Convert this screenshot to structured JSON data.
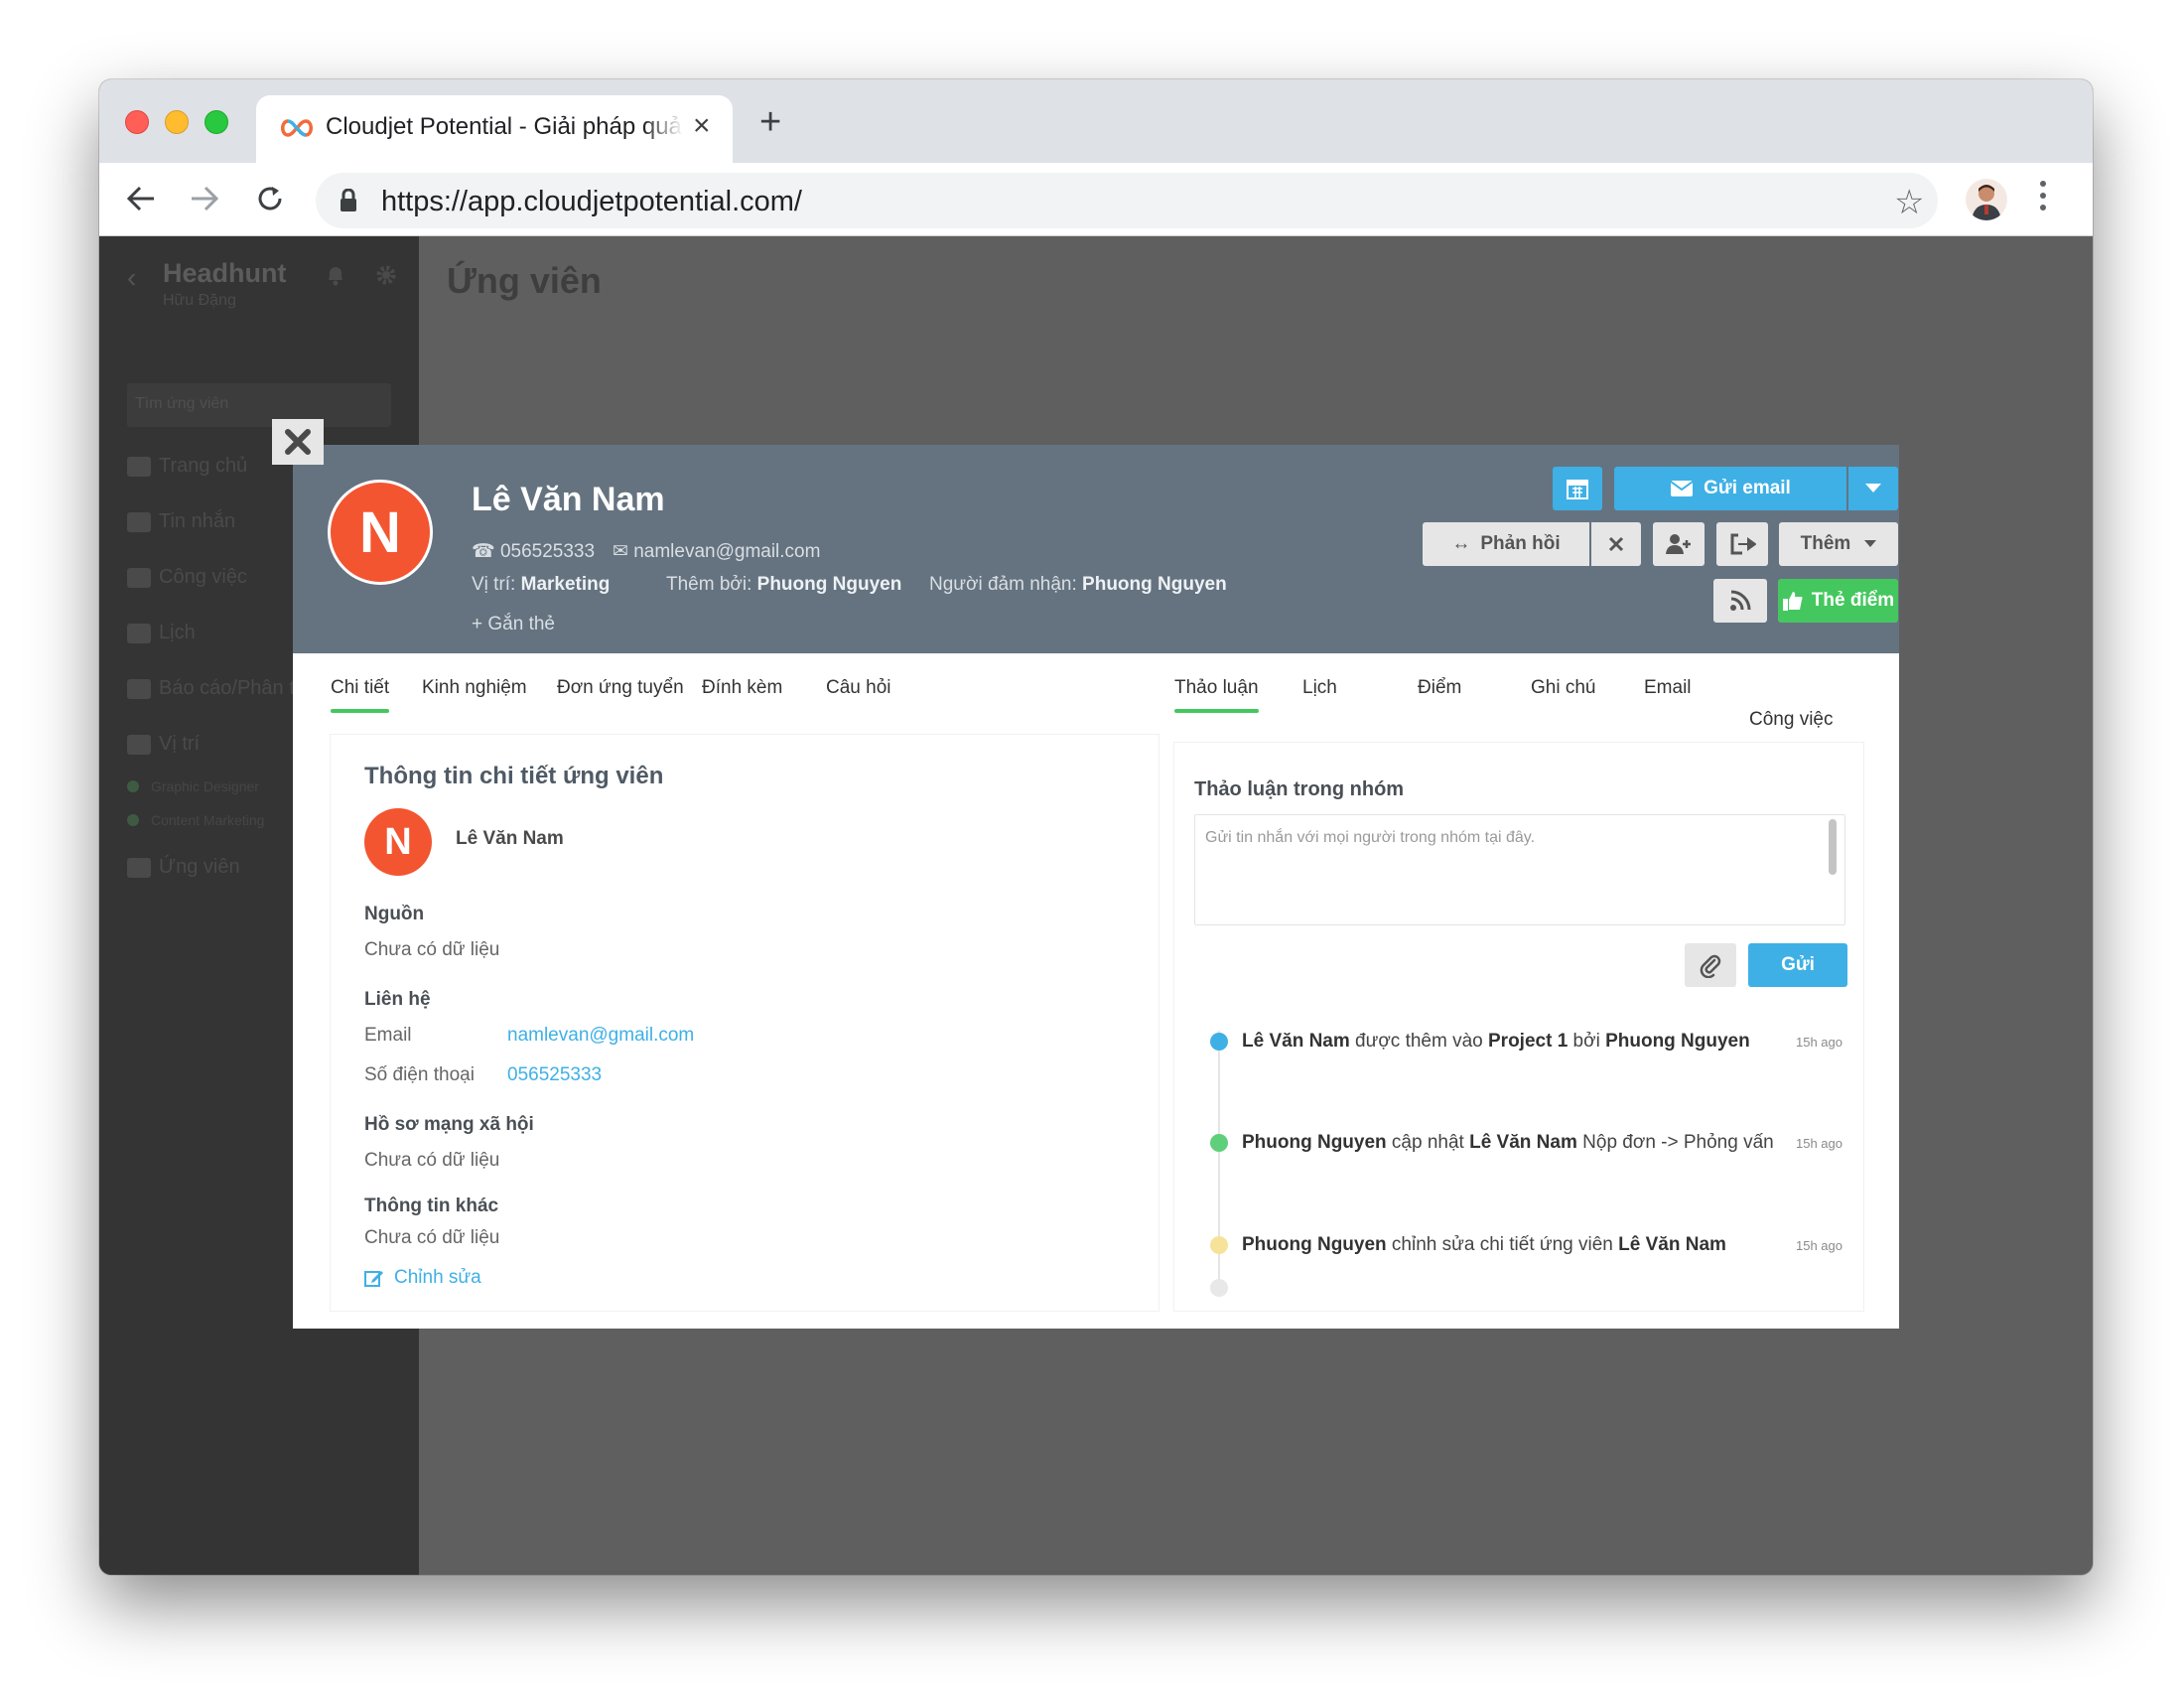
{
  "browser": {
    "tab_title": "Cloudjet Potential - Giải pháp quả",
    "url": "https://app.cloudjetpotential.com/",
    "new_tab_icon": "plus-icon"
  },
  "app": {
    "sidebar": {
      "title": "Headhunt",
      "subtitle": "Hữu Đặng",
      "search_placeholder": "Tìm ứng viên",
      "items": [
        {
          "label": "Trang chủ",
          "icon": "home-icon"
        },
        {
          "label": "Tin nhắn",
          "icon": "envelope-icon"
        },
        {
          "label": "Công việc",
          "icon": "checkbox-icon"
        },
        {
          "label": "Lịch",
          "icon": "calendar-icon"
        },
        {
          "label": "Báo cáo/Phân t",
          "icon": "bar-chart-icon"
        },
        {
          "label": "Vị trí",
          "icon": "briefcase-icon"
        },
        {
          "label": "Ứng viên",
          "icon": "users-icon"
        }
      ],
      "positions": [
        "Graphic Designer",
        "Content Marketing"
      ]
    },
    "page_title": "Ứng viên"
  },
  "candidate": {
    "initial": "N",
    "name": "Lê Văn Nam",
    "phone": "056525333",
    "email": "namlevan@gmail.com",
    "position_label": "Vị trí:",
    "position": "Marketing",
    "added_by_label": "Thêm bởi:",
    "added_by": "Phuong Nguyen",
    "assignee_label": "Người đảm nhận:",
    "assignee": "Phuong Nguyen",
    "add_tag": "Gắn thẻ"
  },
  "actions": {
    "send_email": "Gửi email",
    "feedback": "Phản hồi",
    "more": "Thêm",
    "rate": "Thẻ điểm"
  },
  "left_tabs": [
    "Chi tiết",
    "Kinh nghiệm",
    "Đơn ứng tuyển",
    "Đính kèm",
    "Câu hỏi"
  ],
  "right_tabs": [
    "Thảo luận",
    "Lịch",
    "Điểm",
    "Ghi chú",
    "Email",
    "Công việc"
  ],
  "details": {
    "title": "Thông tin chi tiết ứng viên",
    "source_label": "Nguồn",
    "no_data": "Chưa có dữ liệu",
    "contact_label": "Liên hệ",
    "email_label": "Email",
    "phone_label": "Số điện thoại",
    "social_label": "Hồ sơ mạng xã hội",
    "other_label": "Thông tin khác",
    "edit": "Chỉnh sửa"
  },
  "discussion": {
    "title": "Thảo luận trong nhóm",
    "placeholder": "Gửi tin nhắn với mọi người trong nhóm tại đây.",
    "send": "Gửi",
    "timeline": [
      {
        "actor": "Lê Văn Nam",
        "verb": " được thêm vào ",
        "object": "Project 1",
        "tail": " bởi ",
        "tail_bold": "Phuong Nguyen",
        "time": "15h ago",
        "color": "#3eb0e6"
      },
      {
        "actor": "Phuong Nguyen",
        "verb": " cập nhật ",
        "object": "Lê Văn Nam",
        "tail": " Nộp đơn -> Phỏng vấn",
        "tail_bold": "",
        "time": "15h ago",
        "color": "#5fcf7c"
      },
      {
        "actor": "Phuong Nguyen",
        "verb": " chỉnh sửa chi tiết ứng viên ",
        "object": "Lê Văn Nam",
        "tail": "",
        "tail_bold": "",
        "time": "15h ago",
        "color": "#f7e29a"
      }
    ]
  }
}
